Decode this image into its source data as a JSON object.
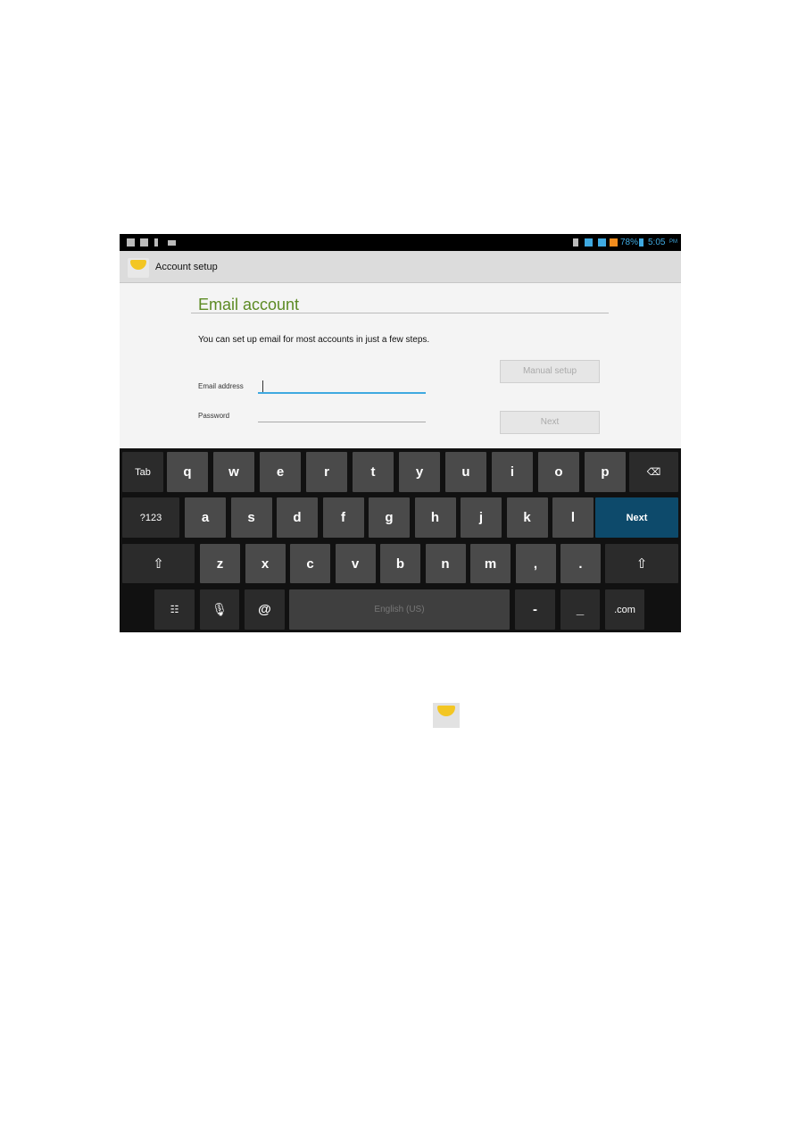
{
  "status_bar": {
    "battery": "78%",
    "time": "5:05",
    "ampm": "PM",
    "icons": [
      "screenshot-icon",
      "image-icon",
      "usb-icon",
      "android-debug-icon",
      "vibrate-icon",
      "wifi-icon",
      "signal-icon",
      "signal-icon",
      "battery-icon"
    ]
  },
  "titlebar": {
    "title": "Account setup",
    "icon": "email-app-icon"
  },
  "form": {
    "heading": "Email account",
    "intro": "You can set up email for most accounts in just a few steps.",
    "email_label": "Email address",
    "email_value": "",
    "password_label": "Password",
    "password_value": "",
    "manual_setup": "Manual setup",
    "next": "Next"
  },
  "keyboard": {
    "row1": [
      "q",
      "w",
      "e",
      "r",
      "t",
      "y",
      "u",
      "i",
      "o",
      "p"
    ],
    "row2": [
      "a",
      "s",
      "d",
      "f",
      "g",
      "h",
      "j",
      "k",
      "l"
    ],
    "row3": [
      "z",
      "x",
      "c",
      "v",
      "b",
      "n",
      "m",
      ",",
      "."
    ],
    "tab": "Tab",
    "symbols": "?123",
    "next": "Next",
    "at": "@",
    "space": "English (US)",
    "dash": "-",
    "underscore": "_",
    "dotcom": ".com",
    "colors": {
      "next": "#0d4a6b",
      "accent": "#3fa9e0"
    }
  }
}
